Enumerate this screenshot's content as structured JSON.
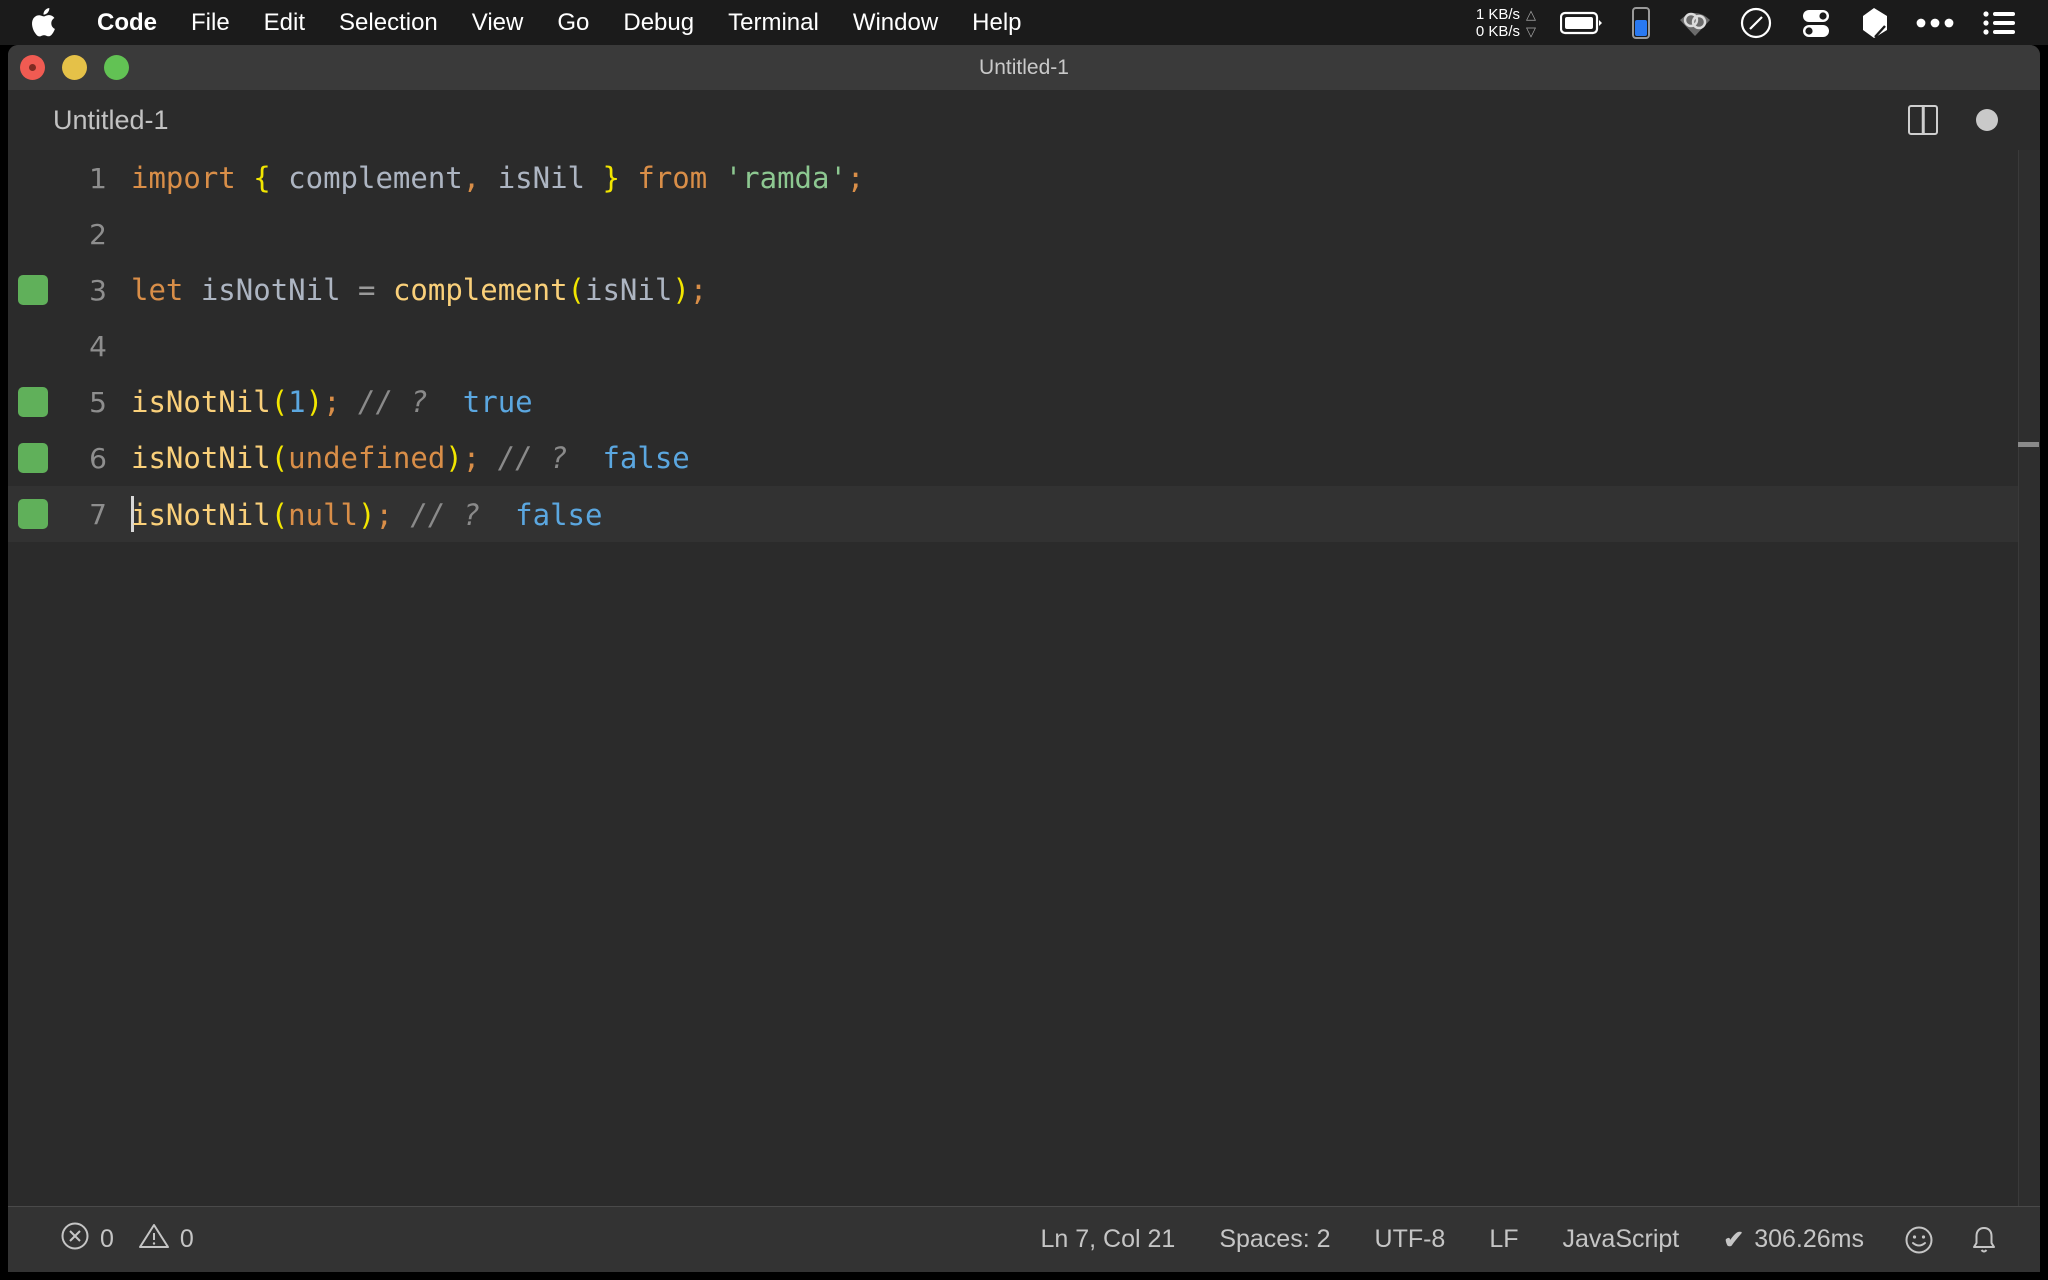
{
  "menubar": {
    "apple_icon": "apple-logo-icon",
    "items": [
      {
        "label": "Code",
        "bold": true
      },
      {
        "label": "File",
        "bold": false
      },
      {
        "label": "Edit",
        "bold": false
      },
      {
        "label": "Selection",
        "bold": false
      },
      {
        "label": "View",
        "bold": false
      },
      {
        "label": "Go",
        "bold": false
      },
      {
        "label": "Debug",
        "bold": false
      },
      {
        "label": "Terminal",
        "bold": false
      },
      {
        "label": "Window",
        "bold": false
      },
      {
        "label": "Help",
        "bold": false
      }
    ],
    "network": {
      "upload": "1 KB/s",
      "download": "0 KB/s",
      "up_arrow": "△",
      "down_arrow": "▽"
    },
    "status_icons": [
      "battery-icon",
      "battery-level-icon",
      "vpn-eye-icon",
      "do-not-disturb-icon",
      "toggles-icon",
      "dropbox-icon",
      "more-ellipsis-icon",
      "control-center-icon"
    ]
  },
  "window": {
    "title": "Untitled-1",
    "traffic_lights": [
      "close-button",
      "minimize-button",
      "maximize-button"
    ]
  },
  "tab": {
    "label": "Untitled-1",
    "split_editor_icon": "split-editor-icon",
    "unsaved_dot": "unsaved-indicator-dot"
  },
  "editor": {
    "lines": [
      {
        "number": "1",
        "breakpoint": false,
        "active": false,
        "tokens": [
          {
            "t": "import",
            "c": "kw"
          },
          {
            "t": " ",
            "c": "ident"
          },
          {
            "t": "{",
            "c": "punc-y"
          },
          {
            "t": " complement",
            "c": "ident"
          },
          {
            "t": ",",
            "c": "semi"
          },
          {
            "t": " isNil ",
            "c": "ident"
          },
          {
            "t": "}",
            "c": "punc-y"
          },
          {
            "t": " ",
            "c": "ident"
          },
          {
            "t": "from",
            "c": "kw"
          },
          {
            "t": " ",
            "c": "ident"
          },
          {
            "t": "'ramda'",
            "c": "str"
          },
          {
            "t": ";",
            "c": "semi"
          }
        ]
      },
      {
        "number": "2",
        "breakpoint": false,
        "active": false,
        "tokens": []
      },
      {
        "number": "3",
        "breakpoint": true,
        "active": false,
        "tokens": [
          {
            "t": "let",
            "c": "kw"
          },
          {
            "t": " isNotNil ",
            "c": "ident"
          },
          {
            "t": "=",
            "c": "op"
          },
          {
            "t": " ",
            "c": "ident"
          },
          {
            "t": "complement",
            "c": "fn"
          },
          {
            "t": "(",
            "c": "punc-y"
          },
          {
            "t": "isNil",
            "c": "ident"
          },
          {
            "t": ")",
            "c": "punc-y"
          },
          {
            "t": ";",
            "c": "semi"
          }
        ]
      },
      {
        "number": "4",
        "breakpoint": false,
        "active": false,
        "tokens": []
      },
      {
        "number": "5",
        "breakpoint": true,
        "active": false,
        "tokens": [
          {
            "t": "isNotNil",
            "c": "fn"
          },
          {
            "t": "(",
            "c": "punc-y"
          },
          {
            "t": "1",
            "c": "bool"
          },
          {
            "t": ")",
            "c": "punc-y"
          },
          {
            "t": ";",
            "c": "semi"
          },
          {
            "t": " // ?  ",
            "c": "cmt"
          },
          {
            "t": "true",
            "c": "bool"
          }
        ]
      },
      {
        "number": "6",
        "breakpoint": true,
        "active": false,
        "tokens": [
          {
            "t": "isNotNil",
            "c": "fn"
          },
          {
            "t": "(",
            "c": "punc-y"
          },
          {
            "t": "undefined",
            "c": "kw"
          },
          {
            "t": ")",
            "c": "punc-y"
          },
          {
            "t": ";",
            "c": "semi"
          },
          {
            "t": " // ?  ",
            "c": "cmt"
          },
          {
            "t": "false",
            "c": "bool"
          }
        ]
      },
      {
        "number": "7",
        "breakpoint": true,
        "active": true,
        "cursor": true,
        "tokens": [
          {
            "t": "isNotNil",
            "c": "fn"
          },
          {
            "t": "(",
            "c": "punc-y"
          },
          {
            "t": "null",
            "c": "kw"
          },
          {
            "t": ")",
            "c": "punc-y"
          },
          {
            "t": ";",
            "c": "semi"
          },
          {
            "t": " // ?  ",
            "c": "cmt"
          },
          {
            "t": "false",
            "c": "bool"
          }
        ]
      }
    ]
  },
  "statusbar": {
    "errors": "0",
    "warnings": "0",
    "error_icon": "error-circle-icon",
    "warning_icon": "warning-triangle-icon",
    "position": "Ln 7, Col 21",
    "indentation": "Spaces: 2",
    "encoding": "UTF-8",
    "eol": "LF",
    "language": "JavaScript",
    "quokka_check": "✔",
    "quokka_time": "306.26ms",
    "feedback_icon": "smiley-face-icon",
    "notification_icon": "bell-icon"
  },
  "colors": {
    "menubar_bg": "#1b1b1b",
    "titlebar_bg": "#3a3a3a",
    "editor_bg": "#2b2b2b",
    "statusbar_bg": "#333333",
    "breakpoint_green": "#60b05a",
    "keyword_orange": "#d98e48",
    "function_yellow": "#fad07a",
    "string_green": "#8dc891",
    "boolean_blue": "#5ba7e0",
    "paren_yellow": "#f2e600",
    "comment_gray": "#8a8a8a"
  }
}
